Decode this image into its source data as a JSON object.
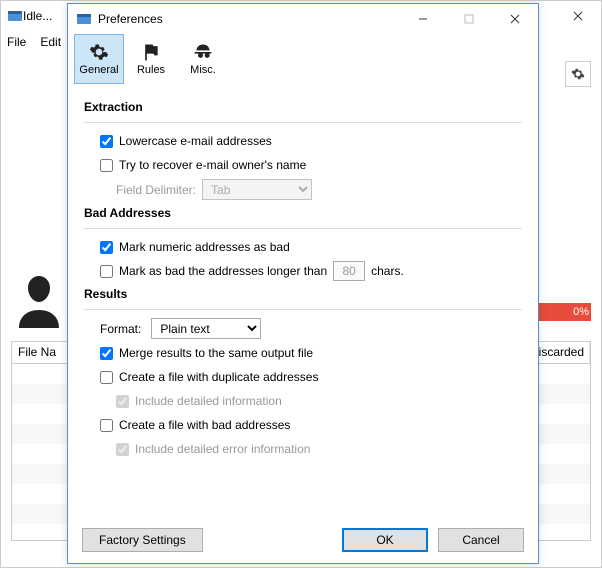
{
  "main": {
    "title": "Idle...",
    "menu": {
      "file": "File",
      "edit": "Edit"
    },
    "progress_text": "0%",
    "table": {
      "col_filename": "File Na",
      "col_discarded": "Discarded"
    }
  },
  "dialog": {
    "title": "Preferences",
    "toolbar": {
      "general": "General",
      "rules": "Rules",
      "misc": "Misc."
    },
    "extraction": {
      "heading": "Extraction",
      "lowercase": "Lowercase e-mail addresses",
      "recover_name": "Try to recover e-mail owner's name",
      "field_delim_label": "Field Delimiter:",
      "field_delim_value": "Tab"
    },
    "bad": {
      "heading": "Bad Addresses",
      "mark_numeric": "Mark numeric addresses as bad",
      "mark_long_pre": "Mark as bad the addresses longer than",
      "mark_long_value": "80",
      "mark_long_post": "chars."
    },
    "results": {
      "heading": "Results",
      "format_label": "Format:",
      "format_value": "Plain text",
      "merge": "Merge results to the same output file",
      "dup_file": "Create a file with duplicate addresses",
      "dup_detail": "Include detailed information",
      "bad_file": "Create a file with bad addresses",
      "bad_detail": "Include detailed error information"
    },
    "buttons": {
      "factory": "Factory Settings",
      "ok": "OK",
      "cancel": "Cancel"
    }
  }
}
